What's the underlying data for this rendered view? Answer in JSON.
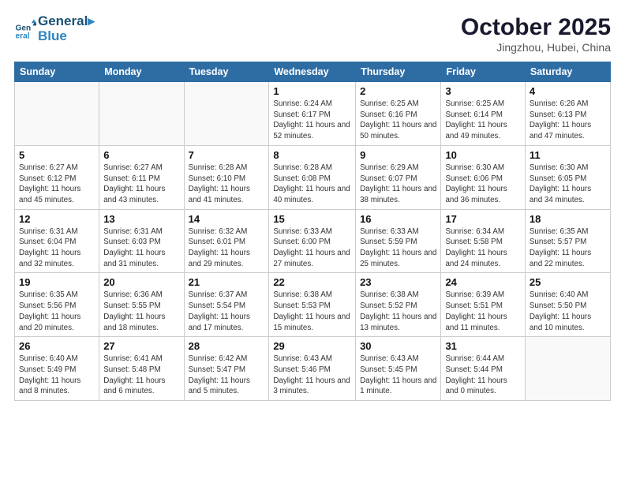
{
  "header": {
    "logo_line1": "General",
    "logo_line2": "Blue",
    "month": "October 2025",
    "location": "Jingzhou, Hubei, China"
  },
  "weekdays": [
    "Sunday",
    "Monday",
    "Tuesday",
    "Wednesday",
    "Thursday",
    "Friday",
    "Saturday"
  ],
  "weeks": [
    [
      {
        "day": "",
        "info": ""
      },
      {
        "day": "",
        "info": ""
      },
      {
        "day": "",
        "info": ""
      },
      {
        "day": "1",
        "info": "Sunrise: 6:24 AM\nSunset: 6:17 PM\nDaylight: 11 hours\nand 52 minutes."
      },
      {
        "day": "2",
        "info": "Sunrise: 6:25 AM\nSunset: 6:16 PM\nDaylight: 11 hours\nand 50 minutes."
      },
      {
        "day": "3",
        "info": "Sunrise: 6:25 AM\nSunset: 6:14 PM\nDaylight: 11 hours\nand 49 minutes."
      },
      {
        "day": "4",
        "info": "Sunrise: 6:26 AM\nSunset: 6:13 PM\nDaylight: 11 hours\nand 47 minutes."
      }
    ],
    [
      {
        "day": "5",
        "info": "Sunrise: 6:27 AM\nSunset: 6:12 PM\nDaylight: 11 hours\nand 45 minutes."
      },
      {
        "day": "6",
        "info": "Sunrise: 6:27 AM\nSunset: 6:11 PM\nDaylight: 11 hours\nand 43 minutes."
      },
      {
        "day": "7",
        "info": "Sunrise: 6:28 AM\nSunset: 6:10 PM\nDaylight: 11 hours\nand 41 minutes."
      },
      {
        "day": "8",
        "info": "Sunrise: 6:28 AM\nSunset: 6:08 PM\nDaylight: 11 hours\nand 40 minutes."
      },
      {
        "day": "9",
        "info": "Sunrise: 6:29 AM\nSunset: 6:07 PM\nDaylight: 11 hours\nand 38 minutes."
      },
      {
        "day": "10",
        "info": "Sunrise: 6:30 AM\nSunset: 6:06 PM\nDaylight: 11 hours\nand 36 minutes."
      },
      {
        "day": "11",
        "info": "Sunrise: 6:30 AM\nSunset: 6:05 PM\nDaylight: 11 hours\nand 34 minutes."
      }
    ],
    [
      {
        "day": "12",
        "info": "Sunrise: 6:31 AM\nSunset: 6:04 PM\nDaylight: 11 hours\nand 32 minutes."
      },
      {
        "day": "13",
        "info": "Sunrise: 6:31 AM\nSunset: 6:03 PM\nDaylight: 11 hours\nand 31 minutes."
      },
      {
        "day": "14",
        "info": "Sunrise: 6:32 AM\nSunset: 6:01 PM\nDaylight: 11 hours\nand 29 minutes."
      },
      {
        "day": "15",
        "info": "Sunrise: 6:33 AM\nSunset: 6:00 PM\nDaylight: 11 hours\nand 27 minutes."
      },
      {
        "day": "16",
        "info": "Sunrise: 6:33 AM\nSunset: 5:59 PM\nDaylight: 11 hours\nand 25 minutes."
      },
      {
        "day": "17",
        "info": "Sunrise: 6:34 AM\nSunset: 5:58 PM\nDaylight: 11 hours\nand 24 minutes."
      },
      {
        "day": "18",
        "info": "Sunrise: 6:35 AM\nSunset: 5:57 PM\nDaylight: 11 hours\nand 22 minutes."
      }
    ],
    [
      {
        "day": "19",
        "info": "Sunrise: 6:35 AM\nSunset: 5:56 PM\nDaylight: 11 hours\nand 20 minutes."
      },
      {
        "day": "20",
        "info": "Sunrise: 6:36 AM\nSunset: 5:55 PM\nDaylight: 11 hours\nand 18 minutes."
      },
      {
        "day": "21",
        "info": "Sunrise: 6:37 AM\nSunset: 5:54 PM\nDaylight: 11 hours\nand 17 minutes."
      },
      {
        "day": "22",
        "info": "Sunrise: 6:38 AM\nSunset: 5:53 PM\nDaylight: 11 hours\nand 15 minutes."
      },
      {
        "day": "23",
        "info": "Sunrise: 6:38 AM\nSunset: 5:52 PM\nDaylight: 11 hours\nand 13 minutes."
      },
      {
        "day": "24",
        "info": "Sunrise: 6:39 AM\nSunset: 5:51 PM\nDaylight: 11 hours\nand 11 minutes."
      },
      {
        "day": "25",
        "info": "Sunrise: 6:40 AM\nSunset: 5:50 PM\nDaylight: 11 hours\nand 10 minutes."
      }
    ],
    [
      {
        "day": "26",
        "info": "Sunrise: 6:40 AM\nSunset: 5:49 PM\nDaylight: 11 hours\nand 8 minutes."
      },
      {
        "day": "27",
        "info": "Sunrise: 6:41 AM\nSunset: 5:48 PM\nDaylight: 11 hours\nand 6 minutes."
      },
      {
        "day": "28",
        "info": "Sunrise: 6:42 AM\nSunset: 5:47 PM\nDaylight: 11 hours\nand 5 minutes."
      },
      {
        "day": "29",
        "info": "Sunrise: 6:43 AM\nSunset: 5:46 PM\nDaylight: 11 hours\nand 3 minutes."
      },
      {
        "day": "30",
        "info": "Sunrise: 6:43 AM\nSunset: 5:45 PM\nDaylight: 11 hours\nand 1 minute."
      },
      {
        "day": "31",
        "info": "Sunrise: 6:44 AM\nSunset: 5:44 PM\nDaylight: 11 hours\nand 0 minutes."
      },
      {
        "day": "",
        "info": ""
      }
    ]
  ]
}
